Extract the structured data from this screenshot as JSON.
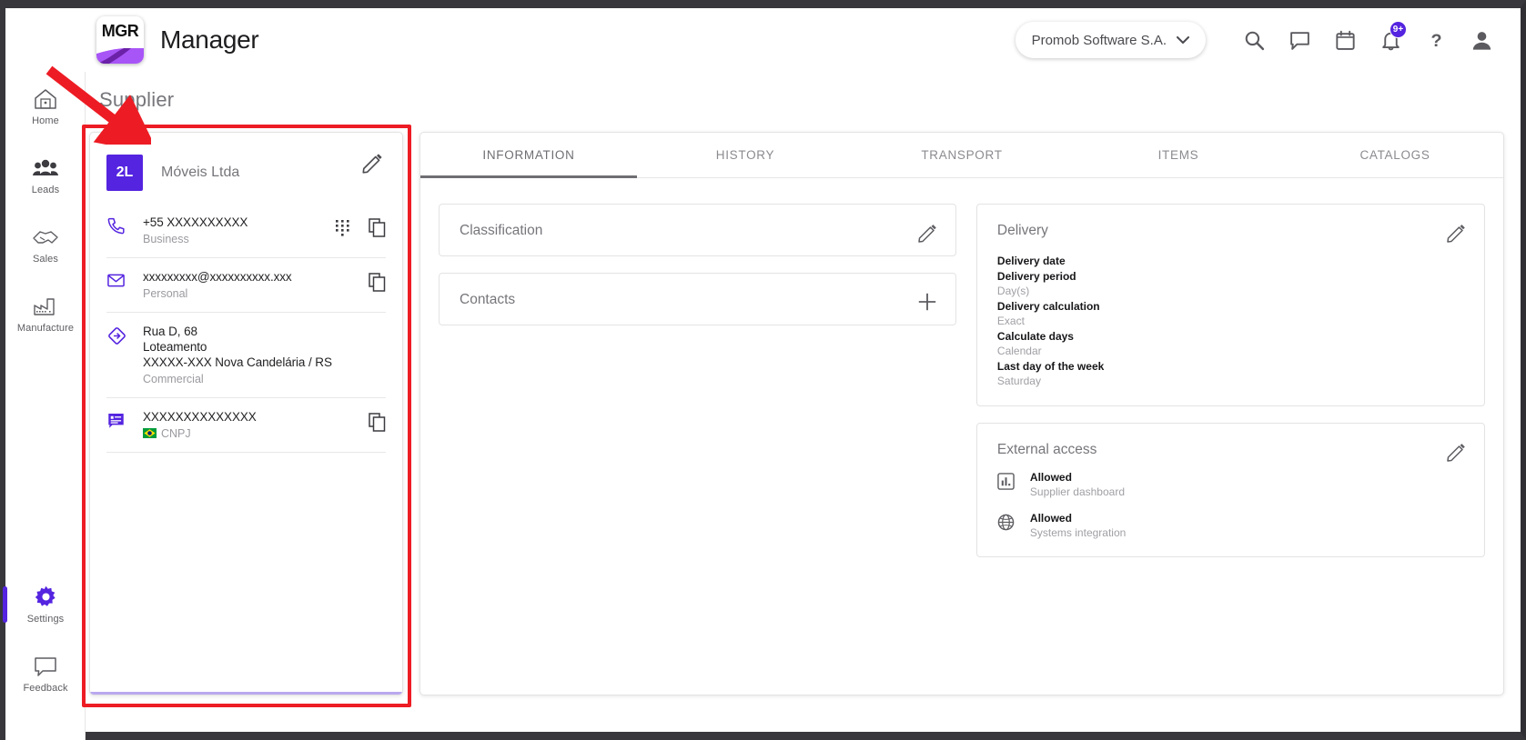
{
  "header": {
    "logo_text": "MGR",
    "app_title": "Manager",
    "company_selector": "Promob Software S.A.",
    "chevron": "chevron-down-icon",
    "icons": [
      {
        "name": "search-icon"
      },
      {
        "name": "chat-icon"
      },
      {
        "name": "calendar-icon"
      },
      {
        "name": "notifications-icon",
        "badge": "9+"
      },
      {
        "name": "help-icon"
      },
      {
        "name": "account-icon"
      }
    ]
  },
  "sidebar": {
    "items": [
      {
        "label": "Home",
        "icon": "home-icon",
        "active": false
      },
      {
        "label": "Leads",
        "icon": "people-icon",
        "active": false
      },
      {
        "label": "Sales",
        "icon": "handshake-icon",
        "active": false
      },
      {
        "label": "Manufacture",
        "icon": "factory-icon",
        "active": false
      },
      {
        "label": "Settings",
        "icon": "gear-icon",
        "active": true
      },
      {
        "label": "Feedback",
        "icon": "feedback-icon",
        "active": false
      }
    ]
  },
  "page": {
    "title": "Supplier"
  },
  "supplier": {
    "avatar_initials": "2L",
    "name": "Móveis Ltda",
    "edit_icon": "pencil-icon",
    "contacts": [
      {
        "icon": "phone-icon",
        "main": "+55 XXXXXXXXXX",
        "sub": "Business",
        "actions": [
          "dialpad-icon",
          "copy-icon"
        ]
      },
      {
        "icon": "email-icon",
        "main": "xxxxxxxxx@xxxxxxxxxx.xxx",
        "sub": "Personal",
        "actions": [
          "copy-icon"
        ]
      },
      {
        "icon": "address-icon",
        "main_line1": "Rua D, 68",
        "main_line2": "Loteamento",
        "main_line3": "XXXXX-XXX Nova Candelária / RS",
        "sub": "Commercial",
        "actions": []
      },
      {
        "icon": "document-icon",
        "main": "XXXXXXXXXXXXXX",
        "sub": "CNPJ",
        "flag": "brazil-flag-icon",
        "actions": [
          "copy-icon"
        ]
      }
    ]
  },
  "tabs": [
    {
      "label": "INFORMATION",
      "active": true
    },
    {
      "label": "HISTORY",
      "active": false
    },
    {
      "label": "TRANSPORT",
      "active": false
    },
    {
      "label": "ITEMS",
      "active": false
    },
    {
      "label": "CATALOGS",
      "active": false
    }
  ],
  "panels": {
    "classification": {
      "title": "Classification",
      "action_icon": "pencil-icon"
    },
    "contacts": {
      "title": "Contacts",
      "action_icon": "plus-icon"
    },
    "delivery": {
      "title": "Delivery",
      "action_icon": "pencil-icon",
      "fields": [
        {
          "label": "Delivery date",
          "value": ""
        },
        {
          "label": "Delivery period",
          "value": "Day(s)"
        },
        {
          "label": "Delivery calculation",
          "value": "Exact"
        },
        {
          "label": "Calculate days",
          "value": "Calendar"
        },
        {
          "label": "Last day of the week",
          "value": "Saturday"
        }
      ]
    },
    "external_access": {
      "title": "External access",
      "action_icon": "pencil-icon",
      "rows": [
        {
          "icon": "chart-icon",
          "status": "Allowed",
          "desc": "Supplier dashboard"
        },
        {
          "icon": "globe-icon",
          "status": "Allowed",
          "desc": "Systems integration"
        }
      ]
    }
  },
  "colors": {
    "accent": "#5424e0",
    "annotation": "#ed1c24",
    "muted": "#a0a0a6"
  }
}
